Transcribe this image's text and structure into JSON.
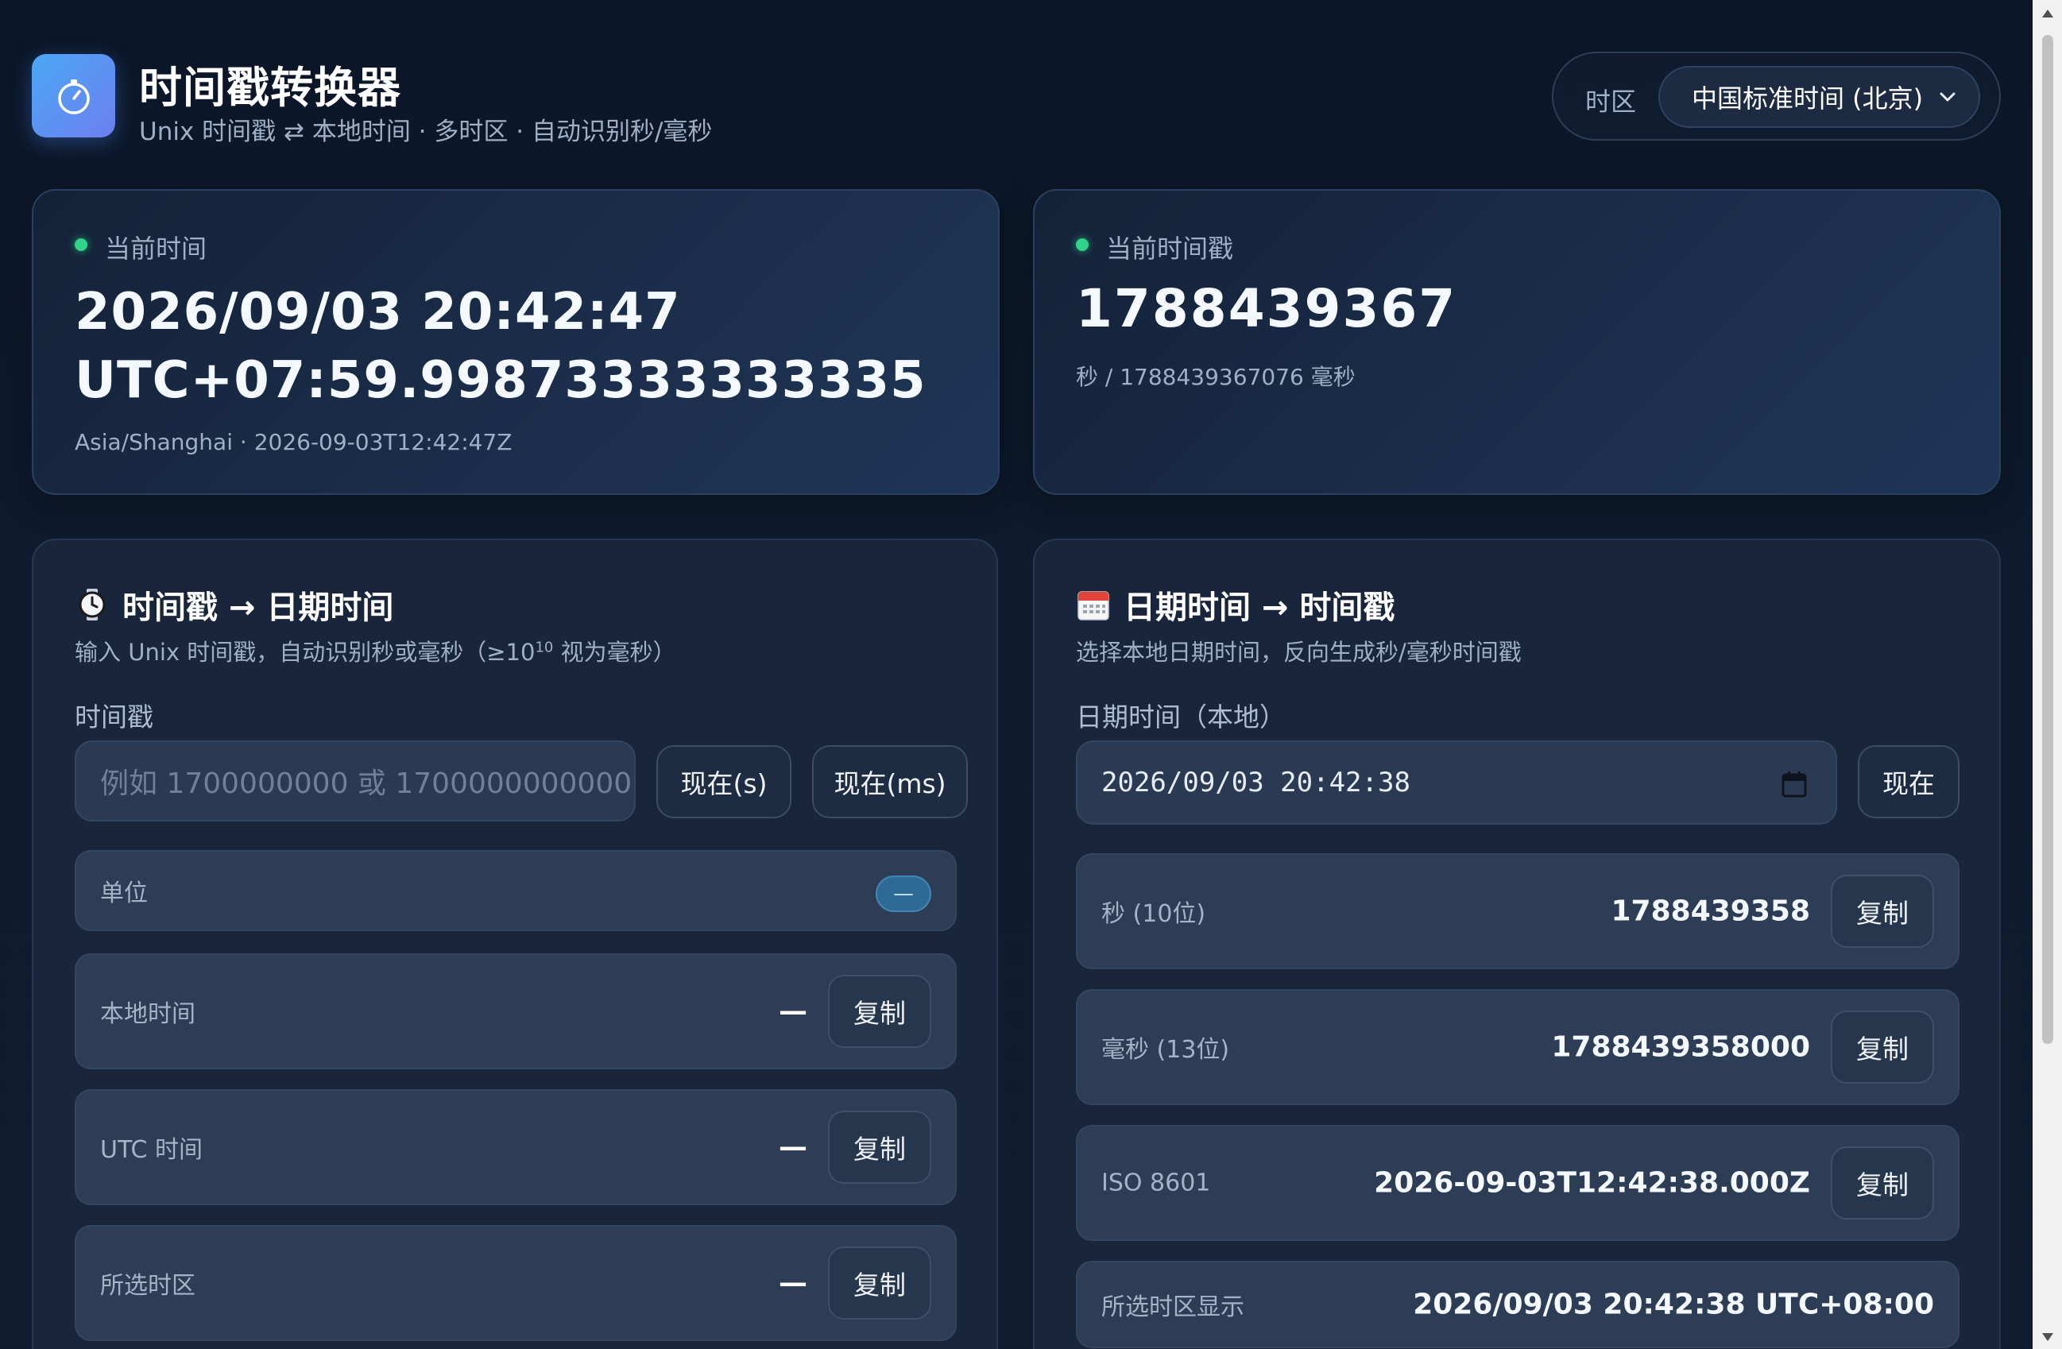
{
  "header": {
    "title": "时间戳转换器",
    "subtitle": "Unix 时间戳 ⇄ 本地时间 · 多时区 · 自动识别秒/毫秒",
    "timezone_label": "时区",
    "timezone_selected": "中国标准时间 (北京)"
  },
  "current_time": {
    "label": "当前时间",
    "value": "2026/09/03 20:42:47 UTC+07:59.99873333333335",
    "sub": "Asia/Shanghai · 2026-09-03T12:42:47Z"
  },
  "current_timestamp": {
    "label": "当前时间戳",
    "value": "1788439367",
    "sub": "秒 / 1788439367076 毫秒"
  },
  "ts_to_date": {
    "title": "时间戳 → 日期时间",
    "desc_prefix": "输入 Unix 时间戳，自动识别秒或毫秒（≥10",
    "desc_sup": "10",
    "desc_suffix": " 视为毫秒）",
    "field_label": "时间戳",
    "input_placeholder": "例如 1700000000 或 1700000000000",
    "btn_now_s": "现在(s)",
    "btn_now_ms": "现在(ms)",
    "unit_label": "单位",
    "unit_value": "—",
    "rows": [
      {
        "label": "本地时间",
        "value": "—",
        "copy": "复制"
      },
      {
        "label": "UTC 时间",
        "value": "—",
        "copy": "复制"
      },
      {
        "label": "所选时区",
        "value": "—",
        "copy": "复制"
      }
    ]
  },
  "date_to_ts": {
    "title": "日期时间 → 时间戳",
    "desc": "选择本地日期时间，反向生成秒/毫秒时间戳",
    "field_label": "日期时间（本地）",
    "input_value": "2026/09/03  20:42:38",
    "btn_now": "现在",
    "rows": [
      {
        "label": "秒 (10位)",
        "value": "1788439358",
        "copy": "复制"
      },
      {
        "label": "毫秒 (13位)",
        "value": "1788439358000",
        "copy": "复制"
      },
      {
        "label": "ISO 8601",
        "value": "2026-09-03T12:42:38.000Z",
        "copy": "复制"
      }
    ],
    "tz_row": {
      "label": "所选时区显示",
      "value": "2026/09/03 20:42:38 UTC+08:00"
    }
  },
  "colors": {
    "accent": "#4aa7f5",
    "live": "#2fd38a",
    "panel": "#18253a"
  }
}
